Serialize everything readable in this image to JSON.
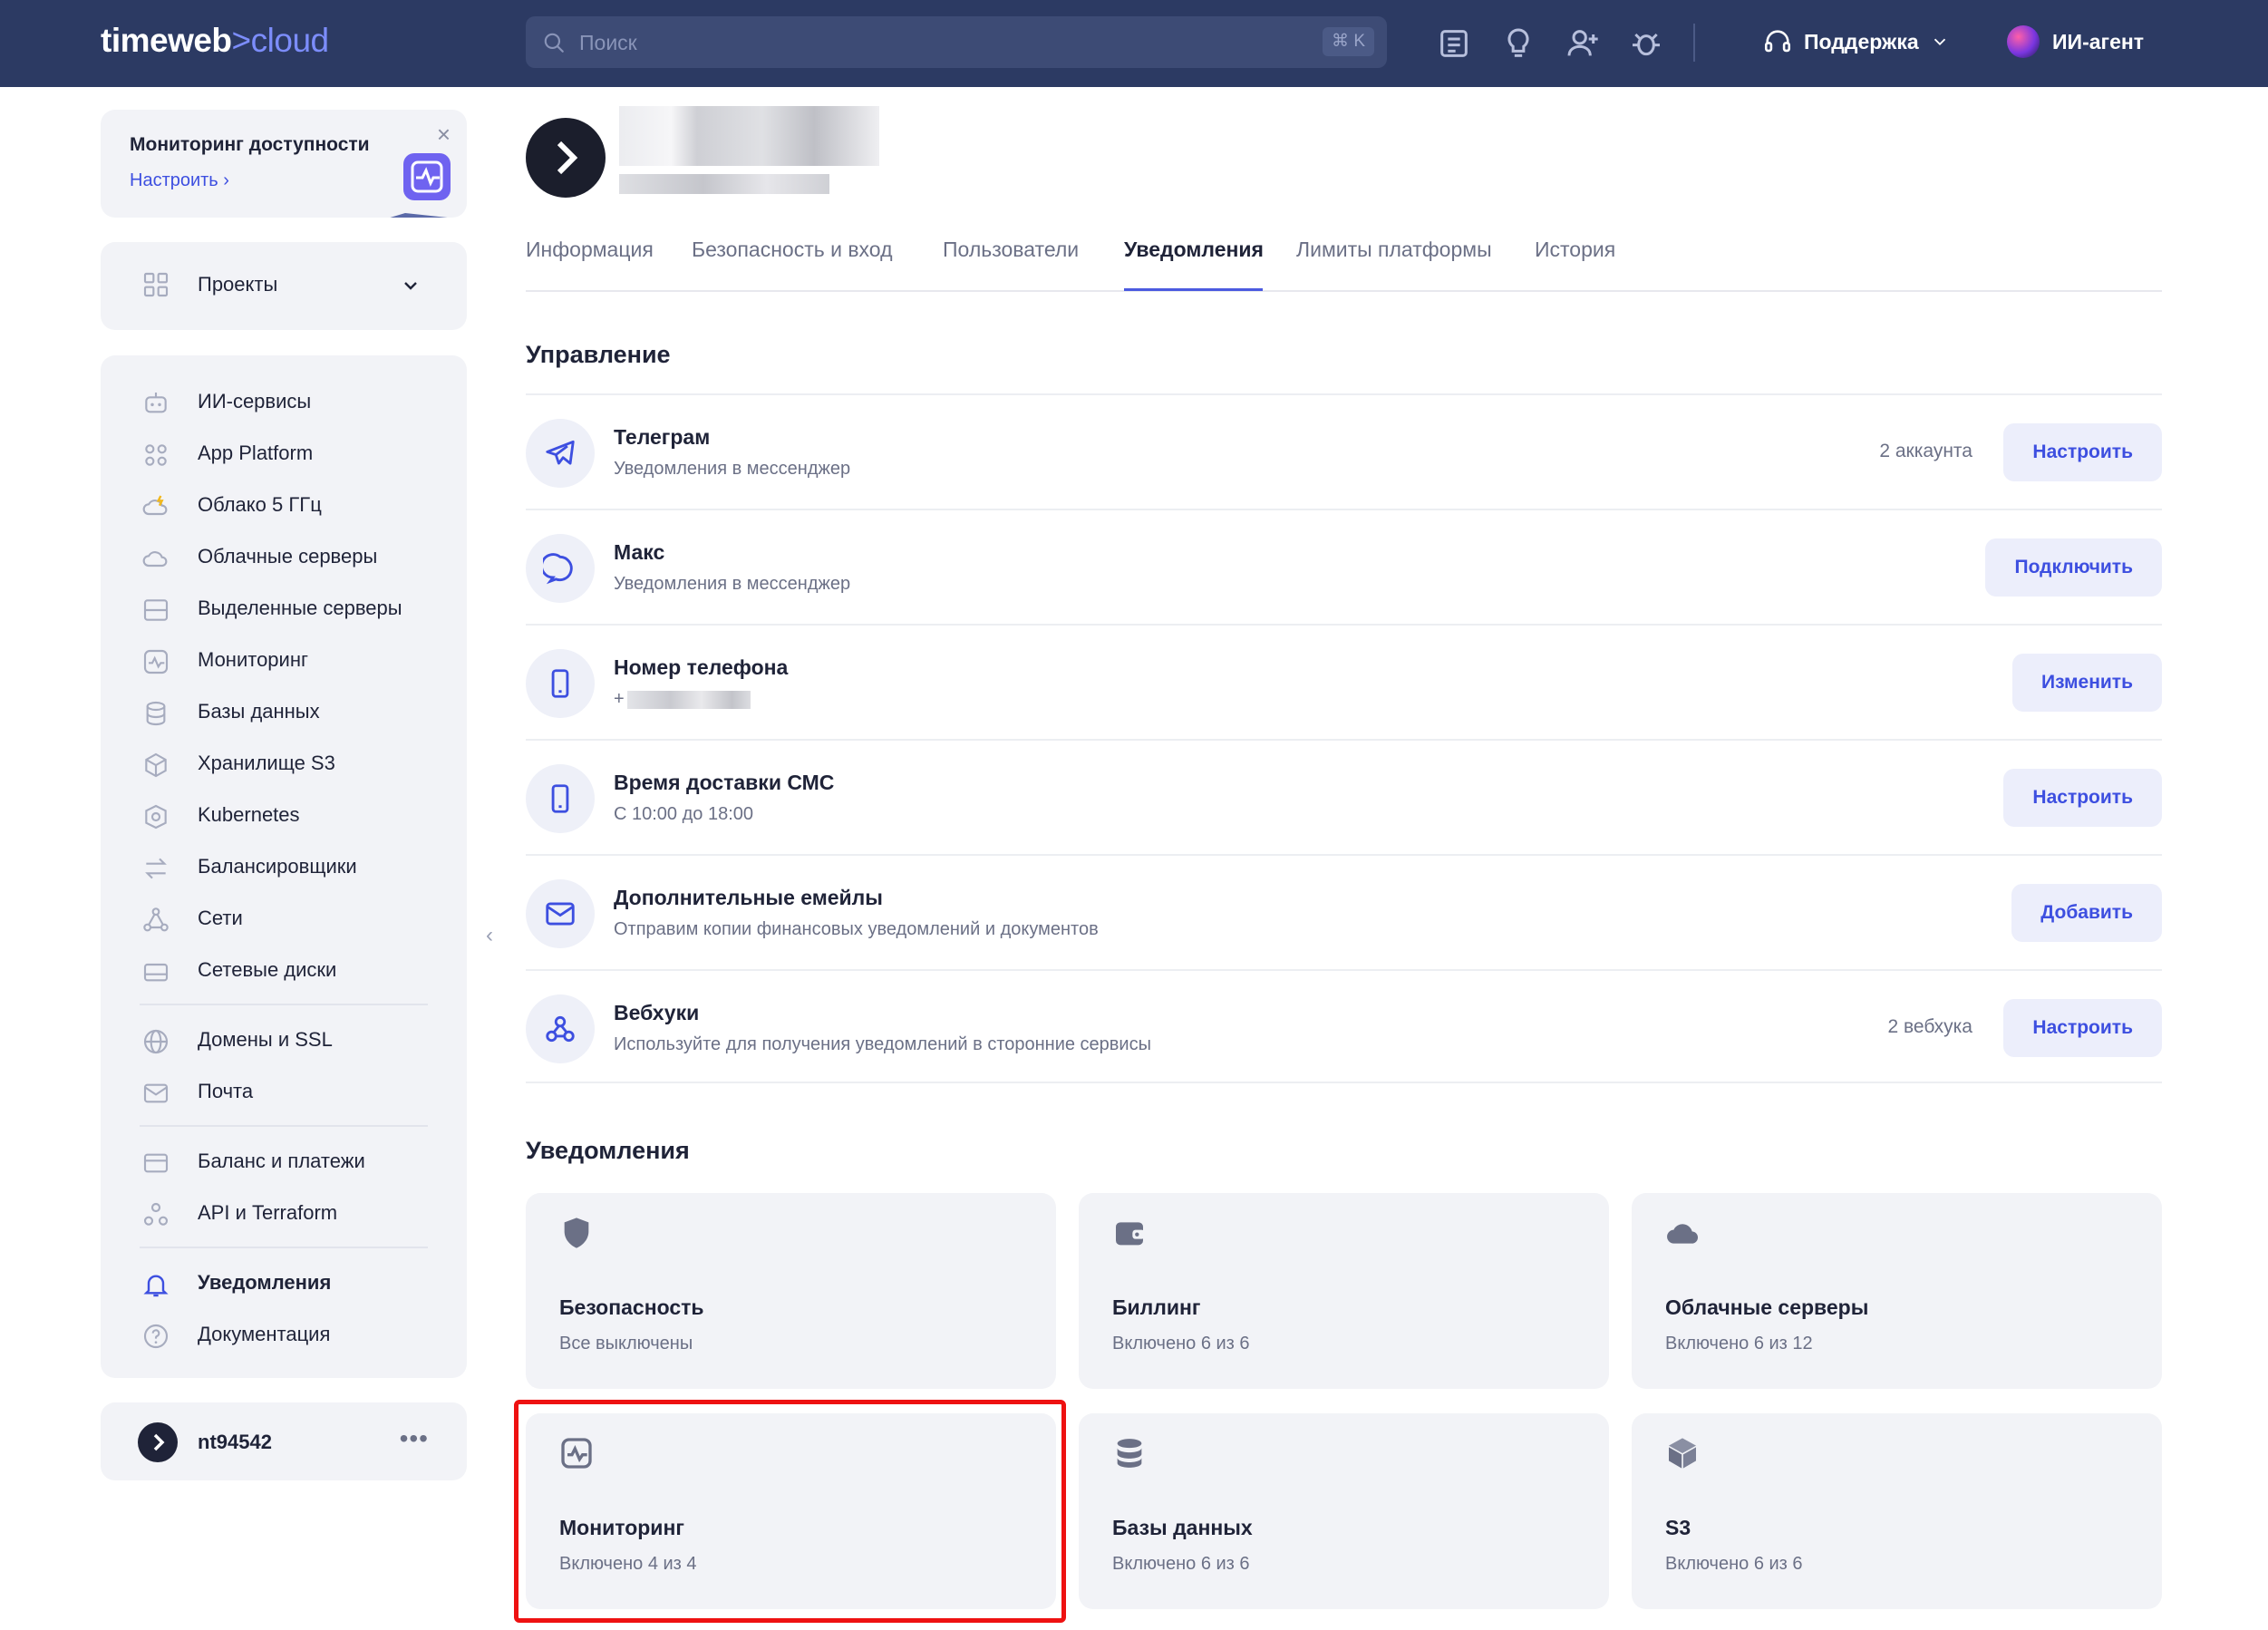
{
  "topbar": {
    "logo_main": "timeweb",
    "logo_accent": ">cloud",
    "search_placeholder": "Поиск",
    "search_shortcut": "⌘ K",
    "support_label": "Поддержка",
    "agent_label": "ИИ-агент"
  },
  "sidebar": {
    "promo": {
      "title": "Мониторинг доступности",
      "link": "Настроить"
    },
    "projects_label": "Проекты",
    "items": [
      {
        "label": "ИИ-сервисы",
        "icon": "robot-icon"
      },
      {
        "label": "App Platform",
        "icon": "grid-icon"
      },
      {
        "label": "Облако 5 ГГц",
        "icon": "cloud-bolt-icon"
      },
      {
        "label": "Облачные серверы",
        "icon": "cloud-icon"
      },
      {
        "label": "Выделенные серверы",
        "icon": "server-icon"
      },
      {
        "label": "Мониторинг",
        "icon": "monitoring-icon"
      },
      {
        "label": "Базы данных",
        "icon": "database-icon"
      },
      {
        "label": "Хранилище S3",
        "icon": "box-icon"
      },
      {
        "label": "Kubernetes",
        "icon": "kubernetes-icon"
      },
      {
        "label": "Балансировщики",
        "icon": "arrows-icon"
      },
      {
        "label": "Сети",
        "icon": "network-icon"
      },
      {
        "label": "Сетевые диски",
        "icon": "disk-icon"
      },
      {
        "label": "Домены и SSL",
        "icon": "globe-icon"
      },
      {
        "label": "Почта",
        "icon": "mail-icon"
      },
      {
        "label": "Баланс и платежи",
        "icon": "card-icon"
      },
      {
        "label": "API и Terraform",
        "icon": "api-icon"
      },
      {
        "label": "Уведомления",
        "icon": "bell-icon"
      },
      {
        "label": "Документация",
        "icon": "help-icon"
      }
    ],
    "user_name": "nt94542",
    "user_more": "•••"
  },
  "tabs": [
    "Информация",
    "Безопасность и вход",
    "Пользователи",
    "Уведомления",
    "Лимиты платформы",
    "История"
  ],
  "management": {
    "heading": "Управление",
    "rows": [
      {
        "title": "Телеграм",
        "subtitle": "Уведомления в мессенджер",
        "count": "2 аккаунта",
        "button": "Настроить",
        "icon": "telegram-icon"
      },
      {
        "title": "Макс",
        "subtitle": "Уведомления в мессенджер",
        "count": "",
        "button": "Подключить",
        "icon": "chat-icon"
      },
      {
        "title": "Номер телефона",
        "subtitle": "+",
        "count": "",
        "button": "Изменить",
        "icon": "phone-icon"
      },
      {
        "title": "Время доставки СМС",
        "subtitle": "С 10:00 до 18:00",
        "count": "",
        "button": "Настроить",
        "icon": "phone-icon"
      },
      {
        "title": "Дополнительные емейлы",
        "subtitle": "Отправим копии финансовых уведомлений и документов",
        "count": "",
        "button": "Добавить",
        "icon": "mail-icon"
      },
      {
        "title": "Вебхуки",
        "subtitle": "Используйте для получения уведомлений в сторонние сервисы",
        "count": "2 вебхука",
        "button": "Настроить",
        "icon": "webhook-icon"
      }
    ]
  },
  "notifications": {
    "heading": "Уведомления",
    "tiles": [
      {
        "title": "Безопасность",
        "status": "Все выключены",
        "icon": "shield-icon"
      },
      {
        "title": "Биллинг",
        "status": "Включено 6 из 6",
        "icon": "wallet-icon"
      },
      {
        "title": "Облачные серверы",
        "status": "Включено 6 из 12",
        "icon": "cloud-icon"
      },
      {
        "title": "Мониторинг",
        "status": "Включено 4 из 4",
        "icon": "monitoring-icon"
      },
      {
        "title": "Базы данных",
        "status": "Включено 6 из 6",
        "icon": "database-icon"
      },
      {
        "title": "S3",
        "status": "Включено 6 из 6",
        "icon": "box-icon"
      }
    ]
  },
  "colors": {
    "topbar": "#2c3a63",
    "accent": "#3d4fe0",
    "highlight": "#ee1111"
  }
}
